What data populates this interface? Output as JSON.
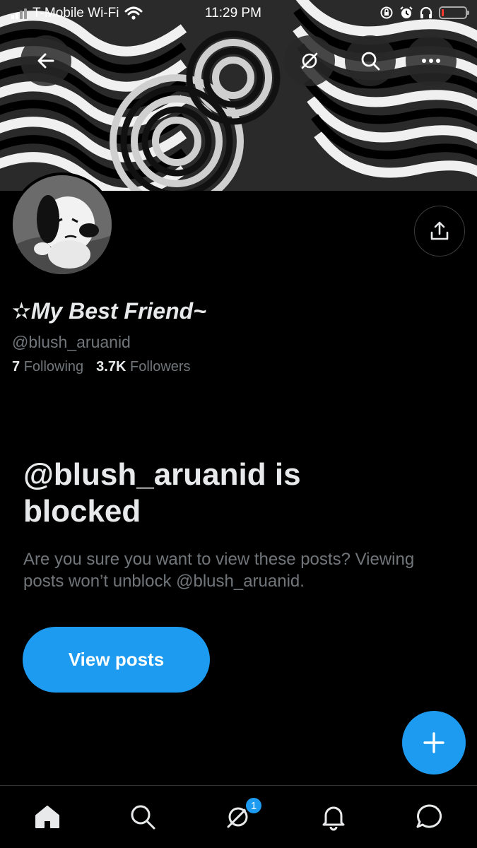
{
  "status_bar": {
    "carrier": "T-Mobile Wi-Fi",
    "time": "11:29 PM"
  },
  "header": {
    "back_icon": "arrow-left-icon",
    "grok_icon": "grok-icon",
    "search_icon": "search-icon",
    "more_icon": "more-icon"
  },
  "profile": {
    "display_name": "✫My Best Friend~",
    "handle": "@blush_aruanid",
    "following_count": "7",
    "following_label": "Following",
    "followers_count": "3.7K",
    "followers_label": "Followers"
  },
  "blocked": {
    "title": "@blush_aruanid is blocked",
    "description": "Are you sure you want to view these posts? Viewing posts won’t unblock @blush_aruanid.",
    "button_label": "View posts"
  },
  "tab_bar": {
    "notification_badge": "1",
    "accent_color": "#1d9bf0"
  }
}
